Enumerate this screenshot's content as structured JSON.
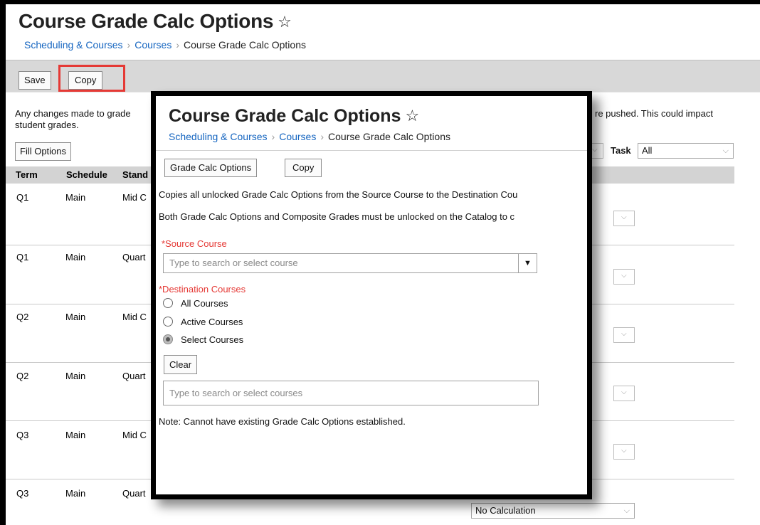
{
  "page": {
    "title": "Course Grade Calc Options",
    "breadcrumbs": [
      "Scheduling & Courses",
      "Courses",
      "Course Grade Calc Options"
    ]
  },
  "toolbar": {
    "save_label": "Save",
    "copy_label": "Copy"
  },
  "notice": {
    "line1_left": "Any changes made to grade",
    "line1_right": "re pushed. This could impact",
    "line2": "student grades."
  },
  "fill_options_label": "Fill Options",
  "filter": {
    "task_label": "Task",
    "task_value": "All"
  },
  "grid": {
    "headers": [
      "Term",
      "Schedule",
      "Stand"
    ],
    "rows": [
      {
        "term": "Q1",
        "schedule": "Main",
        "standard": "Mid C"
      },
      {
        "term": "Q1",
        "schedule": "Main",
        "standard": "Quart"
      },
      {
        "term": "Q2",
        "schedule": "Main",
        "standard": "Mid C"
      },
      {
        "term": "Q2",
        "schedule": "Main",
        "standard": "Quart"
      },
      {
        "term": "Q3",
        "schedule": "Main",
        "standard": "Mid C"
      },
      {
        "term": "Q3",
        "schedule": "Main",
        "standard": "Quart"
      }
    ],
    "last_select_value": "No Calculation"
  },
  "modal": {
    "title": "Course Grade Calc Options",
    "breadcrumbs": [
      "Scheduling & Courses",
      "Courses",
      "Course Grade Calc Options"
    ],
    "tab_grade_calc_label": "Grade Calc Options",
    "tab_copy_label": "Copy",
    "info1": "Copies all unlocked Grade Calc Options from the Source Course to the Destination Cou",
    "info2": "Both Grade Calc Options and Composite Grades must be unlocked on the Catalog to c",
    "source_label": "*Source Course",
    "source_placeholder": "Type to search or select course",
    "destination_label": "*Destination Courses",
    "destination_options": [
      "All Courses",
      "Active Courses",
      "Select Courses"
    ],
    "selected_option": "Select Courses",
    "clear_label": "Clear",
    "courses_placeholder": "Type to search or select courses",
    "note": "Note: Cannot have existing Grade Calc Options established."
  }
}
